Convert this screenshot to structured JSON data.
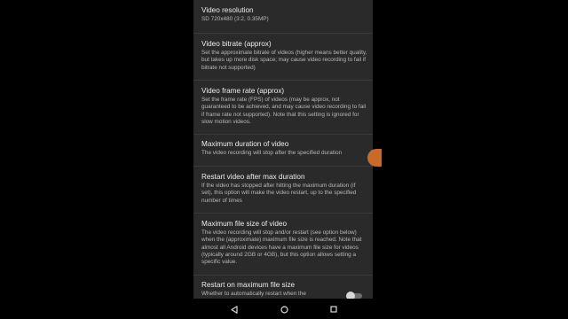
{
  "settings": [
    {
      "title": "Video resolution",
      "summary": "SD 720x480 (3:2, 0.35MP)"
    },
    {
      "title": "Video bitrate (approx)",
      "summary": "Set the approximate bitrate of videos (higher means better quality, but takes up more disk space; may cause video recording to fail if bitrate not supported)"
    },
    {
      "title": "Video frame rate (approx)",
      "summary": "Set the frame rate (FPS) of videos (may be approx, not guaranteed to be achieved, and may cause video recording to fail if frame rate not supported). Note that this setting is ignored for slow motion videos."
    },
    {
      "title": "Maximum duration of video",
      "summary": "The video recording will stop after the specified duration"
    },
    {
      "title": "Restart video after max duration",
      "summary": "If the video has stopped after hitting the maximum duration (if set), this option will make the video restart, up to the specified number of times"
    },
    {
      "title": "Maximum file size of video",
      "summary": "The video recording will stop and/or restart (see option below) when the (approximate) maximum file size is reached. Note that almost all Android devices have a maximum file size for videos (typically around 2GB or 4GB), but this option allows setting a specific value."
    },
    {
      "title": "Restart on maximum file size",
      "summary": "Whether to automatically restart when the"
    }
  ],
  "toggle_restart_on_max_file_size": {
    "state": "off"
  },
  "nav_bar": {
    "icons": [
      "back-icon",
      "home-icon",
      "recents-icon"
    ]
  },
  "colors": {
    "background": "#2a2a2a",
    "accent": "#c86a2a",
    "title_text": "#ececec",
    "summary_text": "#b8b8b8"
  }
}
